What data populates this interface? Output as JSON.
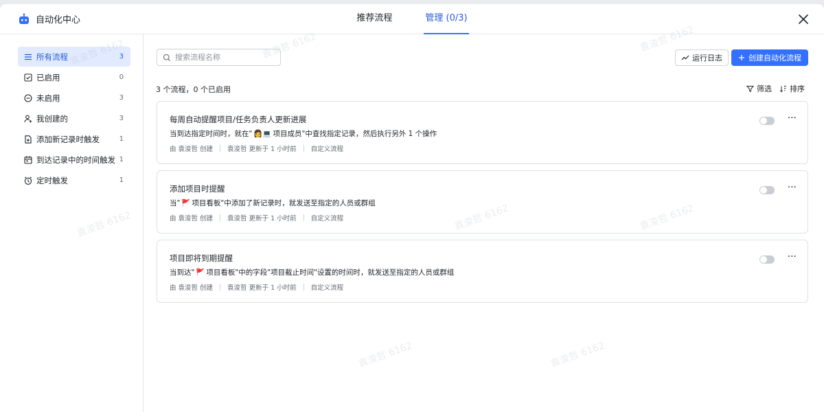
{
  "app": {
    "title": "自动化中心"
  },
  "tabs": [
    {
      "label": "推荐流程",
      "active": false
    },
    {
      "label": "管理 (0/3)",
      "active": true
    }
  ],
  "sidebar": {
    "items": [
      {
        "label": "所有流程",
        "count": "3",
        "icon": "list-icon",
        "active": true
      },
      {
        "label": "已启用",
        "count": "0",
        "icon": "check-square-icon",
        "active": false
      },
      {
        "label": "未启用",
        "count": "3",
        "icon": "minus-circle-icon",
        "active": false
      },
      {
        "label": "我创建的",
        "count": "3",
        "icon": "user-add-icon",
        "active": false
      },
      {
        "label": "添加新记录时触发",
        "count": "1",
        "icon": "doc-add-icon",
        "active": false
      },
      {
        "label": "到达记录中的时间触发",
        "count": "1",
        "icon": "calendar-icon",
        "active": false
      },
      {
        "label": "定时触发",
        "count": "1",
        "icon": "alarm-icon",
        "active": false
      }
    ]
  },
  "toolbar": {
    "search_placeholder": "搜索流程名称",
    "log_label": "运行日志",
    "create_label": "创建自动化流程",
    "summary": "3 个流程，0 个已启用",
    "filter_label": "筛选",
    "sort_label": "排序"
  },
  "flows": [
    {
      "title": "每周自动提醒项目/任务负责人更新进展",
      "desc_pre": "当到达指定时间时，就在\"",
      "desc_emoji": "👩💻",
      "desc_post": " 项目成员\"中查找指定记录，然后执行另外 1 个操作",
      "creator": "由 袁浚哲 创建",
      "updated": "袁浚哲 更新于 1 小时前",
      "kind": "自定义流程",
      "enabled": false
    },
    {
      "title": "添加项目时提醒",
      "desc_pre": "当\"",
      "desc_emoji": "🚩",
      "desc_post": " 项目看板\"中添加了新记录时，就发送至指定的人员或群组",
      "creator": "由 袁浚哲 创建",
      "updated": "袁浚哲 更新于 1 小时前",
      "kind": "自定义流程",
      "enabled": false
    },
    {
      "title": "项目即将到期提醒",
      "desc_pre": "当到达\"",
      "desc_emoji": "🚩",
      "desc_post": " 项目看板\"中的字段\"项目截止时间\"设置的时间时，就发送至指定的人员或群组",
      "creator": "由 袁浚哲 创建",
      "updated": "袁浚哲 更新于 1 小时前",
      "kind": "自定义流程",
      "enabled": false
    }
  ],
  "more_glyph": "···",
  "watermark": "袁浚哲 6162",
  "colors": {
    "accent": "#3370ff",
    "accent_text": "#245bdb",
    "active_bg": "#e1eaff"
  }
}
